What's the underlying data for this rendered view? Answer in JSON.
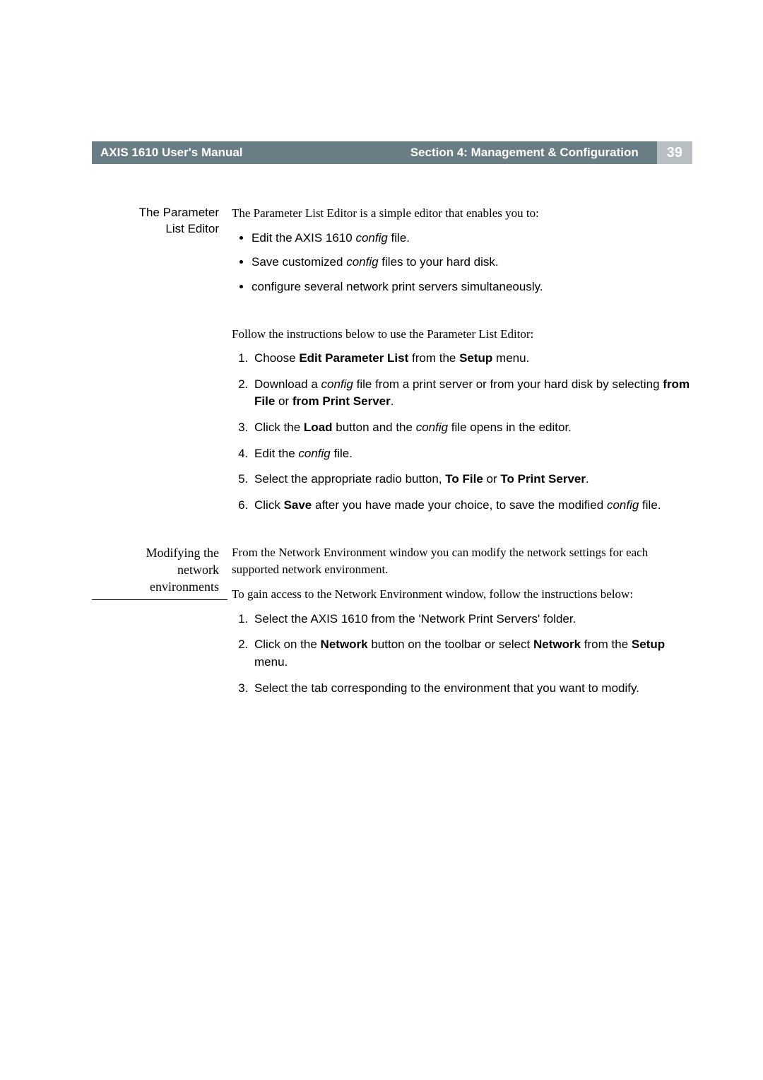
{
  "header": {
    "manual_title": "AXIS 1610 User's Manual",
    "section_title": "Section 4: Management & Configuration",
    "page_number": "39"
  },
  "section1": {
    "side_label_l1": "The Parameter",
    "side_label_l2": "List Editor",
    "intro": "The Parameter List Editor is a simple editor that enables you to:",
    "bullets": {
      "b1_pre": "Edit the AXIS 1610 ",
      "b1_it": "config",
      "b1_post": " file.",
      "b2_pre": "Save customized ",
      "b2_it": "config",
      "b2_post": " files to your hard disk.",
      "b3": "configure several network print servers simultaneously."
    },
    "lead2": "Follow the instructions below to use the Parameter List Editor:",
    "steps": {
      "s1_a": "Choose ",
      "s1_b": "Edit Parameter List",
      "s1_c": " from the ",
      "s1_d": "Setup",
      "s1_e": " menu.",
      "s2_a": "Download a ",
      "s2_it": "config",
      "s2_b": " file from a print server or from your hard disk by selecting ",
      "s2_c": "from File",
      "s2_d": " or ",
      "s2_e": "from Print Server",
      "s2_f": ".",
      "s3_a": "Click the ",
      "s3_b": "Load",
      "s3_c": " button and the ",
      "s3_it": "config",
      "s3_d": " file opens in the editor.",
      "s4_a": "Edit the ",
      "s4_it": "config",
      "s4_b": " file.",
      "s5_a": "Select the appropriate radio button, ",
      "s5_b": "To File",
      "s5_c": " or ",
      "s5_d": "To Print Server",
      "s5_e": ".",
      "s6_a": "Click ",
      "s6_b": "Save",
      "s6_c": " after you have made your choice, to save the modified ",
      "s6_it": "config",
      "s6_d": " file."
    }
  },
  "section2": {
    "side_label_l1": "Modifying the",
    "side_label_l2": "network",
    "side_label_l3": "environments",
    "p1": "From the Network Environment window you can modify the network settings for each supported network environment.",
    "p2": "To gain access to the Network Environment window, follow the instructions below:",
    "steps": {
      "s1": "Select the AXIS 1610 from the 'Network Print Servers' folder.",
      "s2_a": "Click on the ",
      "s2_b": "Network",
      "s2_c": " button on the toolbar or select ",
      "s2_d": "Network",
      "s2_e": " from the ",
      "s2_f": "Setup",
      "s2_g": " menu.",
      "s3": "Select the tab corresponding to the environment that you want to modify."
    }
  }
}
